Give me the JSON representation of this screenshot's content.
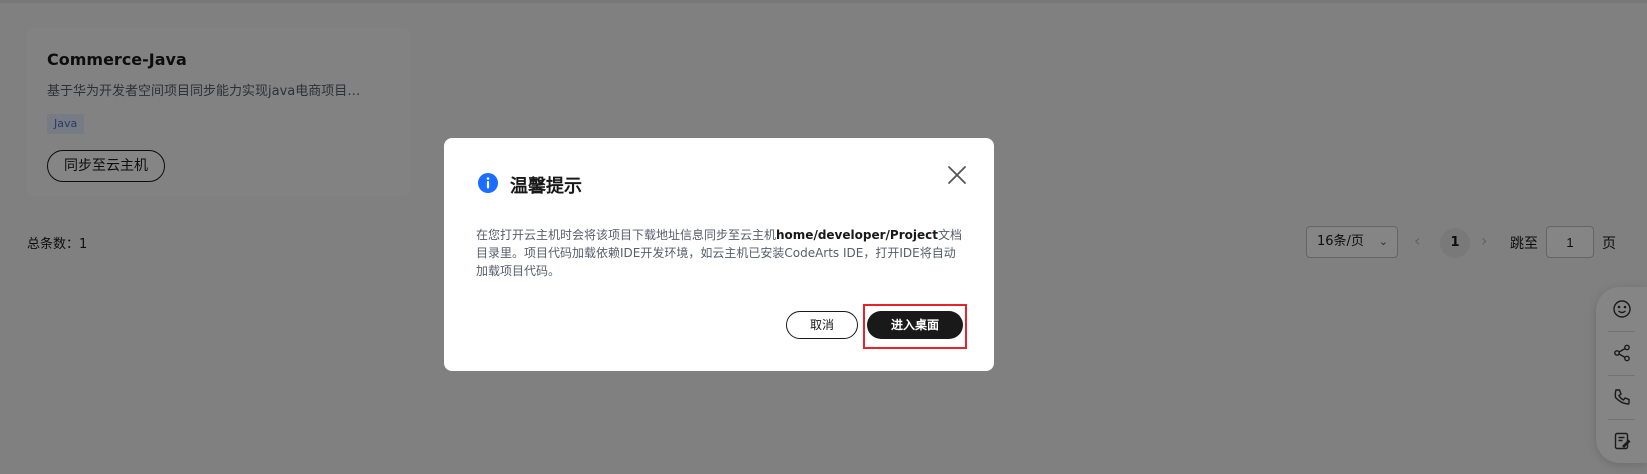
{
  "card": {
    "title": "Commerce-Java",
    "description": "基于华为开发者空间项目同步能力实现java电商项目…",
    "tag": "Java",
    "sync_button": "同步至云主机"
  },
  "summary": {
    "total_label": "总条数：1"
  },
  "pagination": {
    "page_size": "16条/页",
    "current_page": "1",
    "jump_label": "跳至",
    "jump_value": "1",
    "page_suffix": "页"
  },
  "float_tools": {
    "icons": [
      "smile-icon",
      "share-icon",
      "phone-icon",
      "feedback-icon"
    ]
  },
  "dialog": {
    "title": "温馨提示",
    "body_before": "在您打开云主机时会将该项目下载地址信息同步至云主机",
    "body_path": "home/developer/Project",
    "body_after": "文档目录里。项目代码加载依赖IDE开发环境，如云主机已安装CodeArts IDE，打开IDE将自动加载项目代码。",
    "cancel_label": "取消",
    "confirm_label": "进入桌面"
  },
  "colors": {
    "info_icon": "#1a6dff",
    "highlight_box": "#e5242b",
    "primary_button": "#191919"
  }
}
